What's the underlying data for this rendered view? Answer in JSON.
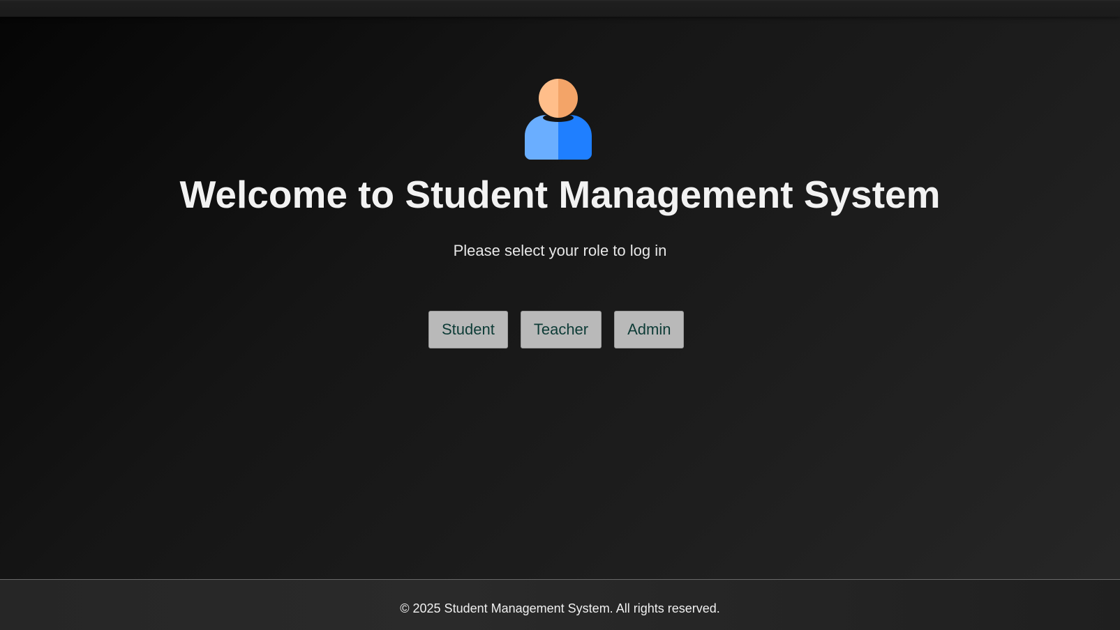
{
  "hero": {
    "title": "Welcome to Student Management System",
    "subtitle": "Please select your role to log in",
    "icon": "user-avatar-icon"
  },
  "roles": {
    "student_label": "Student",
    "teacher_label": "Teacher",
    "admin_label": "Admin"
  },
  "footer": {
    "text": "© 2025 Student Management System. All rights reserved."
  },
  "colors": {
    "avatar_head": "#f6a86c",
    "avatar_body": "#2f8cff",
    "button_bg": "#b9b9b9",
    "button_text": "#0d3b36"
  }
}
